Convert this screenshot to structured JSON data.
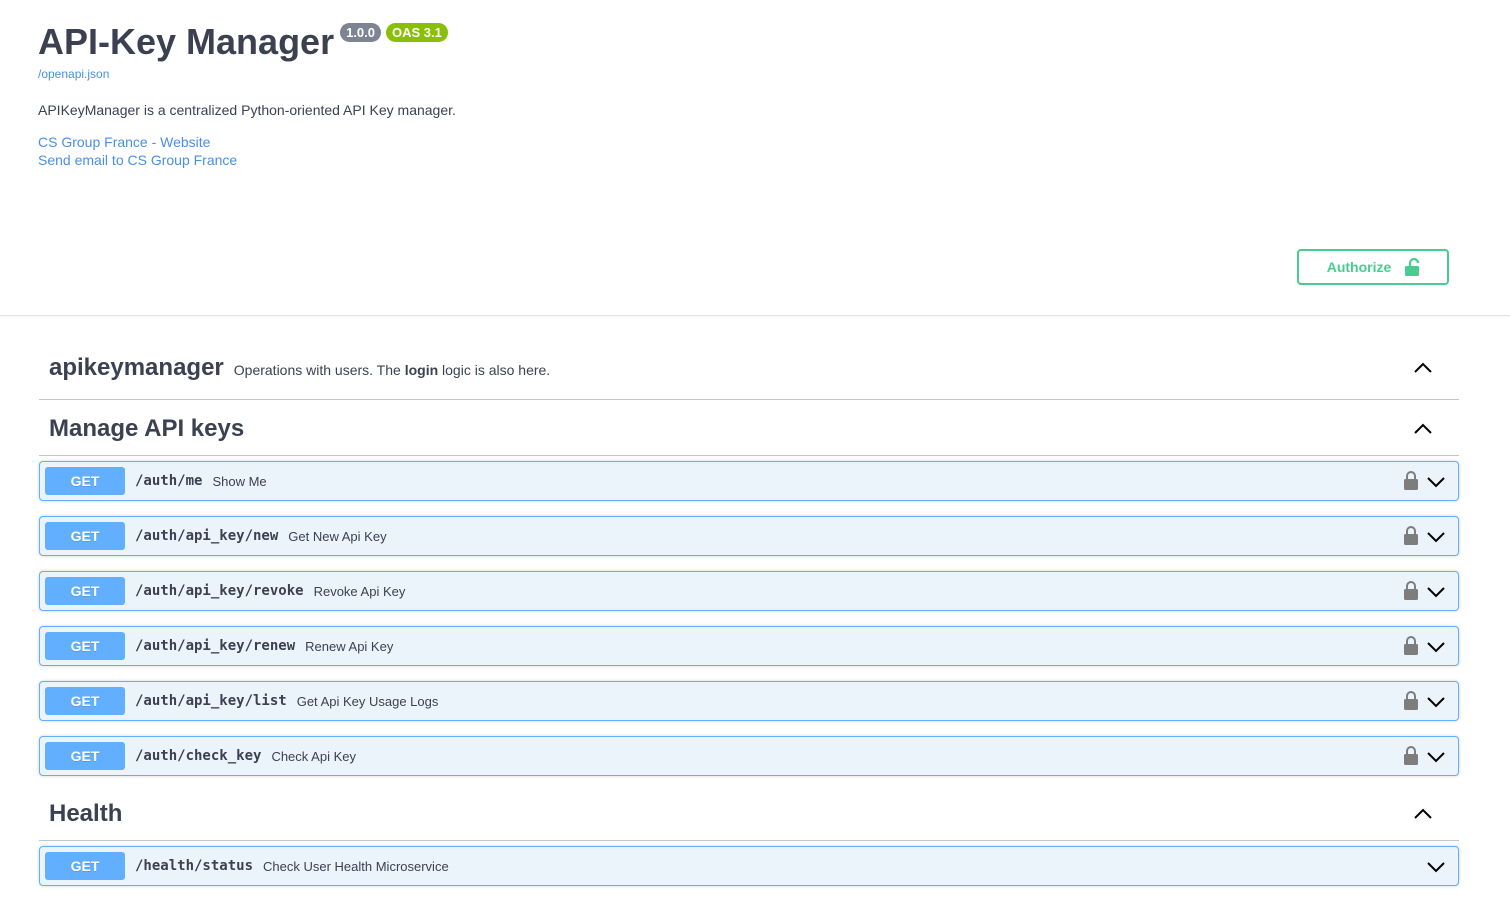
{
  "info": {
    "title": "API-Key Manager",
    "version": "1.0.0",
    "oas": "OAS 3.1",
    "spec_link": "/openapi.json",
    "description": "APIKeyManager is a centralized Python-oriented API Key manager.",
    "contact_website": "CS Group France - Website",
    "contact_email": "Send email to CS Group France"
  },
  "authorize": {
    "label": "Authorize",
    "icon": "unlocked-lock-icon",
    "color": "#49cc90"
  },
  "colors": {
    "get": "#61affe",
    "link": "#4990e2",
    "badge_version": "#7d8492",
    "badge_oas": "#89bf04"
  },
  "tags": [
    {
      "name": "apikeymanager",
      "description_pre": "Operations with users. The ",
      "description_bold": "login",
      "description_post": " logic is also here."
    },
    {
      "name": "Manage API keys"
    },
    {
      "name": "Health"
    }
  ],
  "operations": [
    {
      "method": "GET",
      "path": "/auth/me",
      "summary": "Show Me"
    },
    {
      "method": "GET",
      "path": "/auth/api_key/new",
      "summary": "Get New Api Key"
    },
    {
      "method": "GET",
      "path": "/auth/api_key/revoke",
      "summary": "Revoke Api Key"
    },
    {
      "method": "GET",
      "path": "/auth/api_key/renew",
      "summary": "Renew Api Key"
    },
    {
      "method": "GET",
      "path": "/auth/api_key/list",
      "summary": "Get Api Key Usage Logs"
    },
    {
      "method": "GET",
      "path": "/auth/check_key",
      "summary": "Check Api Key"
    },
    {
      "method": "GET",
      "path": "/health/status",
      "summary": "Check User Health Microservice"
    }
  ]
}
